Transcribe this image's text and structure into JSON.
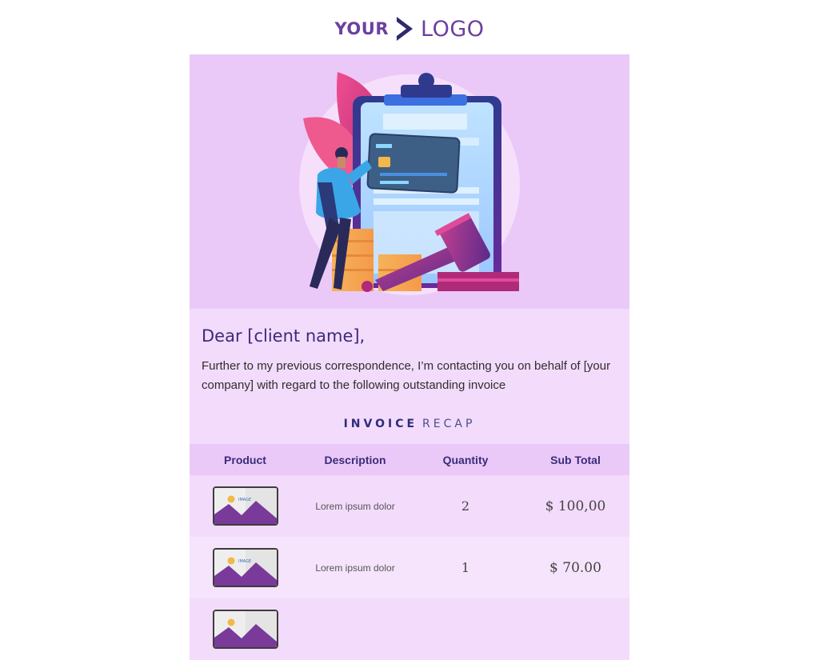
{
  "brand": {
    "logo_word1": "YOUR",
    "logo_word2": "LOGO"
  },
  "message": {
    "greeting": "Dear [client name],",
    "body": "Further to my previous correspondence, I’m contacting you on behalf of [your company] with regard to the following outstanding invoice"
  },
  "recap": {
    "bold": "INVOICE",
    "light": "RECAP"
  },
  "table": {
    "headers": [
      "Product",
      "Description",
      "Quantity",
      "Sub Total"
    ],
    "rows": [
      {
        "description": "Lorem ipsum dolor",
        "quantity": "2",
        "subtotal": "$ 100,00",
        "image_label": "IMAGE"
      },
      {
        "description": "Lorem ipsum dolor",
        "quantity": "1",
        "subtotal": "$ 70.00",
        "image_label": "IMAGE"
      }
    ]
  }
}
